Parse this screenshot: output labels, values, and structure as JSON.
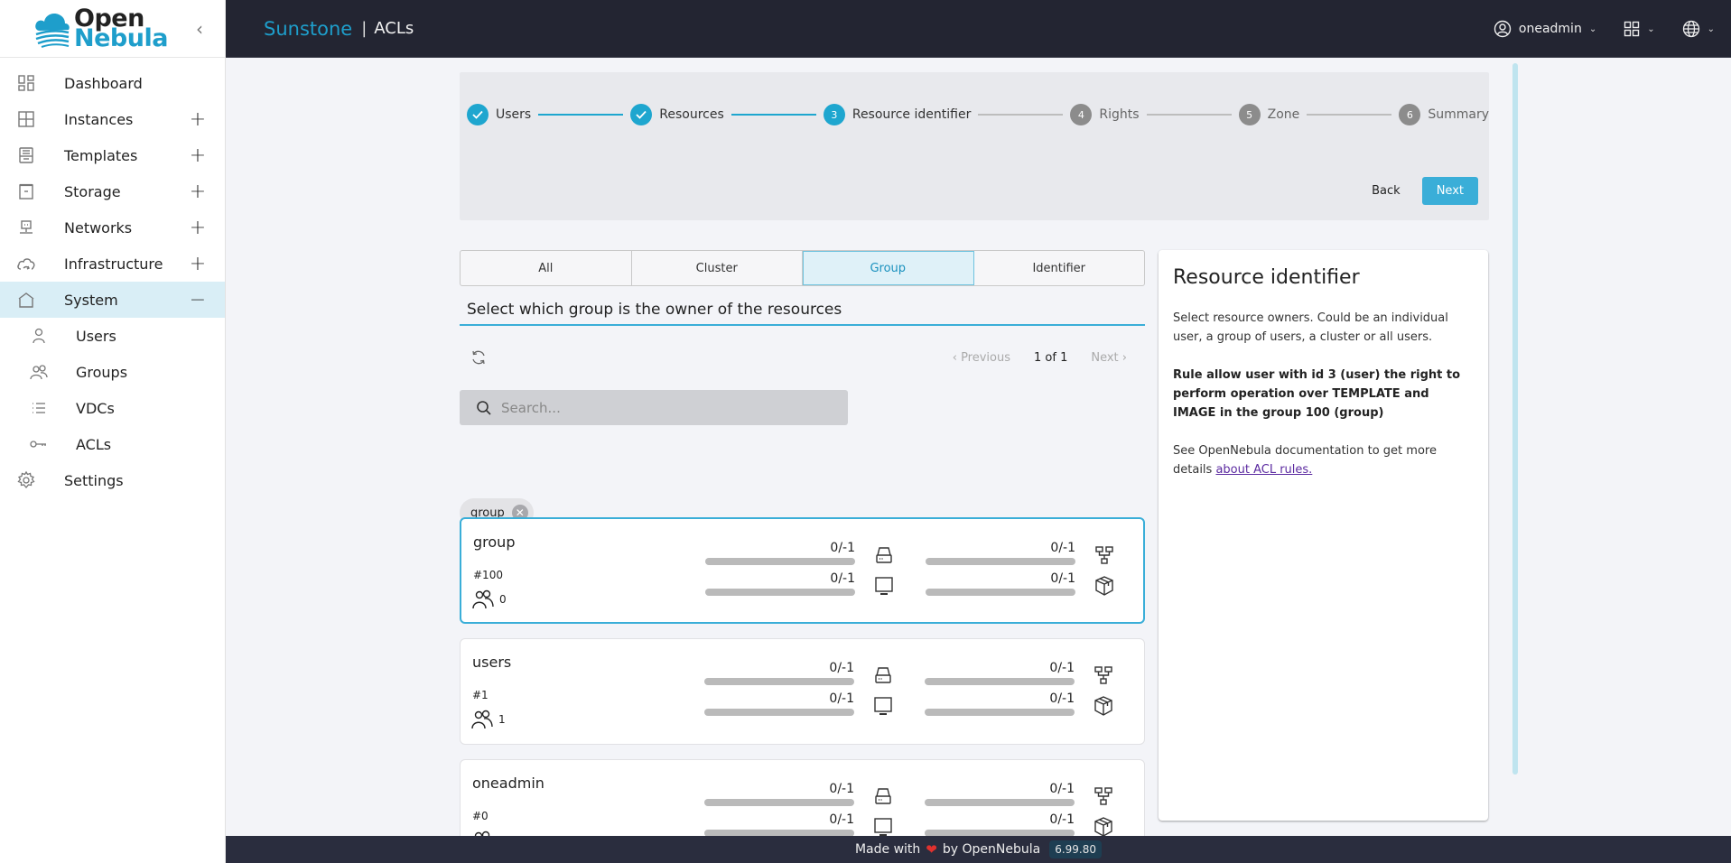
{
  "app": {
    "logo_line1": "Open",
    "logo_line2": "Nebula",
    "brand": "Sunstone",
    "separator": "|",
    "page_title": "ACLs"
  },
  "header": {
    "user_label": "oneadmin",
    "icons": [
      "user-circle-icon",
      "apps-grid-icon",
      "globe-icon"
    ]
  },
  "sidebar": {
    "items": [
      {
        "label": "Dashboard",
        "icon": "dashboard-icon",
        "expander": ""
      },
      {
        "label": "Instances",
        "icon": "instances-icon",
        "expander": "+"
      },
      {
        "label": "Templates",
        "icon": "templates-icon",
        "expander": "+"
      },
      {
        "label": "Storage",
        "icon": "storage-icon",
        "expander": "+"
      },
      {
        "label": "Networks",
        "icon": "networks-icon",
        "expander": "+"
      },
      {
        "label": "Infrastructure",
        "icon": "infrastructure-icon",
        "expander": "+"
      },
      {
        "label": "System",
        "icon": "system-icon",
        "expander": "−",
        "active": true
      },
      {
        "label": "Settings",
        "icon": "settings-icon",
        "expander": ""
      }
    ],
    "system_children": [
      {
        "label": "Users",
        "icon": "user-icon"
      },
      {
        "label": "Groups",
        "icon": "groups-icon"
      },
      {
        "label": "VDCs",
        "icon": "list-icon"
      },
      {
        "label": "ACLs",
        "icon": "key-icon"
      }
    ]
  },
  "stepper": {
    "steps": [
      {
        "index": "1",
        "label": "Users",
        "state": "done"
      },
      {
        "index": "2",
        "label": "Resources",
        "state": "done"
      },
      {
        "index": "3",
        "label": "Resource identifier",
        "state": "current"
      },
      {
        "index": "4",
        "label": "Rights",
        "state": "todo"
      },
      {
        "index": "5",
        "label": "Zone",
        "state": "todo"
      },
      {
        "index": "6",
        "label": "Summary",
        "state": "todo"
      }
    ],
    "back_label": "Back",
    "next_label": "Next"
  },
  "tabs": [
    {
      "label": "All",
      "active": false
    },
    {
      "label": "Cluster",
      "active": false
    },
    {
      "label": "Group",
      "active": true
    },
    {
      "label": "Identifier",
      "active": false
    }
  ],
  "section_title": "Select which group is the owner of the resources",
  "pager": {
    "previous_label": "Previous",
    "current": "1 of 1",
    "next_label": "Next"
  },
  "search": {
    "placeholder": "Search...",
    "value": ""
  },
  "filter_chip": {
    "label": "group"
  },
  "groups": [
    {
      "name": "group",
      "id": "#100",
      "users": "0",
      "selected": true,
      "quotas": [
        {
          "value": "0/-1",
          "icon": "datastore-icon",
          "fraction": 0
        },
        {
          "value": "0/-1",
          "icon": "network-icon",
          "fraction": 0
        },
        {
          "value": "0/-1",
          "icon": "vm-monitor-icon",
          "fraction": 0
        },
        {
          "value": "0/-1",
          "icon": "image-box-icon",
          "fraction": 0
        }
      ]
    },
    {
      "name": "users",
      "id": "#1",
      "users": "1",
      "selected": false,
      "quotas": [
        {
          "value": "0/-1",
          "icon": "datastore-icon",
          "fraction": 0
        },
        {
          "value": "0/-1",
          "icon": "network-icon",
          "fraction": 0
        },
        {
          "value": "0/-1",
          "icon": "vm-monitor-icon",
          "fraction": 0
        },
        {
          "value": "0/-1",
          "icon": "image-box-icon",
          "fraction": 0
        }
      ]
    },
    {
      "name": "oneadmin",
      "id": "#0",
      "users": "",
      "selected": false,
      "quotas": [
        {
          "value": "0/-1",
          "icon": "datastore-icon",
          "fraction": 0
        },
        {
          "value": "0/-1",
          "icon": "network-icon",
          "fraction": 0
        },
        {
          "value": "0/-1",
          "icon": "vm-monitor-icon",
          "fraction": 0
        },
        {
          "value": "0/-1",
          "icon": "image-box-icon",
          "fraction": 0
        }
      ]
    }
  ],
  "help": {
    "title": "Resource identifier",
    "description": "Select resource owners. Could be an individual user, a group of users, a cluster or all users.",
    "rule": "Rule allow user with id 3 (user) the right to perform operation over TEMPLATE and IMAGE in the group 100 (group)",
    "doc_prefix": "See OpenNebula documentation to get more details ",
    "doc_link": "about ACL rules."
  },
  "footer": {
    "made_with": "Made with",
    "heart": "❤",
    "by": "by OpenNebula",
    "version": "6.99.80"
  },
  "colors": {
    "accent": "#1ea6cf",
    "header_bg": "#232532",
    "footer_bg": "#2a2d3e",
    "active_nav_bg": "#d9eef6"
  }
}
